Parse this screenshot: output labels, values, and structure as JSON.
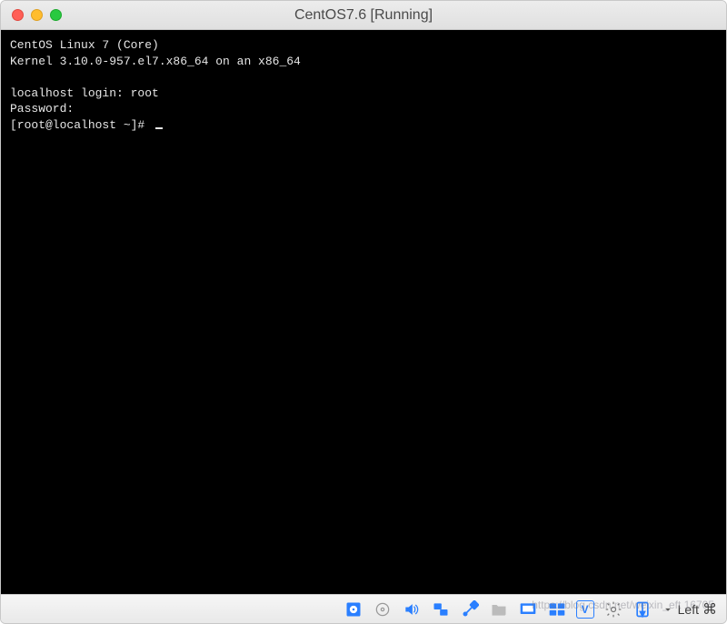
{
  "title": "CentOS7.6 [Running]",
  "terminal": {
    "line1": "CentOS Linux 7 (Core)",
    "line2": "Kernel 3.10.0-957.el7.x86_64 on an x86_64",
    "line3": "",
    "login_prompt": "localhost login: root",
    "password_prompt": "Password:",
    "shell_prompt": "[root@localhost ~]# "
  },
  "statusbar": {
    "keyboard_indicator": "V",
    "host_key_label": "Left",
    "host_key_symbol": "⌘"
  },
  "watermark": "https://blog.csdn.net/weixin_eft 16705"
}
